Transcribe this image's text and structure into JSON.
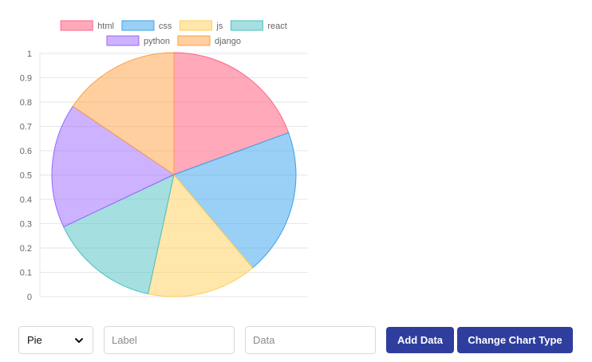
{
  "chart_data": {
    "type": "pie",
    "categories": [
      "html",
      "css",
      "js",
      "react",
      "python",
      "django"
    ],
    "values": [
      20,
      20,
      15,
      15,
      17,
      16
    ],
    "colors": {
      "fills": [
        "rgba(255,99,132,0.55)",
        "rgba(54,162,235,0.5)",
        "rgba(255,206,86,0.5)",
        "rgba(75,192,192,0.5)",
        "rgba(153,102,255,0.5)",
        "rgba(255,159,64,0.5)"
      ],
      "borders": [
        "#ff6384",
        "#36a2eb",
        "#ffce56",
        "#4bc0c0",
        "#9966ff",
        "#ff9f40"
      ]
    },
    "y_ticks": [
      "1",
      "0.9",
      "0.8",
      "0.7",
      "0.6",
      "0.5",
      "0.4",
      "0.3",
      "0.2",
      "0.1",
      "0"
    ],
    "ylim": [
      0,
      1
    ],
    "grid": true,
    "legend_position": "top"
  },
  "controls": {
    "chart_type_select": {
      "value": "Pie"
    },
    "label_input": {
      "placeholder": "Label",
      "value": ""
    },
    "data_input": {
      "placeholder": "Data",
      "value": ""
    },
    "add_data_label": "Add Data",
    "change_chart_type_label": "Change Chart Type"
  }
}
